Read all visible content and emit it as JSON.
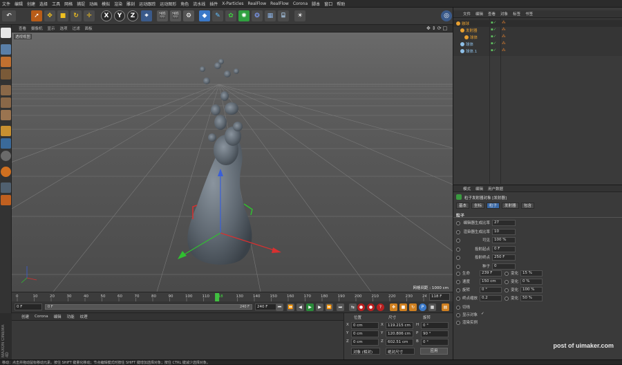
{
  "menu": [
    "文件",
    "编辑",
    "创建",
    "选择",
    "工具",
    "网格",
    "捕捉",
    "动画",
    "模拟",
    "渲染",
    "雕刻",
    "运动跟踪",
    "运动图形",
    "角色",
    "流水线",
    "插件",
    "X-Particles",
    "RealFlow",
    "RealFlow",
    "Corona",
    "脚本",
    "窗口",
    "帮助"
  ],
  "viewport": {
    "menu": [
      "查看",
      "摄像机",
      "显示",
      "选项",
      "过滤",
      "面板"
    ],
    "label": "透视视图",
    "grid_distance": "网格间距 : 1000 cm"
  },
  "timeline": {
    "ticks": [
      "0",
      "10",
      "20",
      "30",
      "40",
      "50",
      "60",
      "70",
      "80",
      "90",
      "100",
      "110",
      "118",
      "130",
      "140",
      "150",
      "160",
      "170",
      "180",
      "190",
      "200",
      "210",
      "220",
      "230",
      "240"
    ],
    "current_frame": "118 F",
    "current_value": 118,
    "end_value": 240
  },
  "playback": {
    "start": "0 F",
    "min": "0 F",
    "max": "240 F",
    "end": "240 F"
  },
  "material": {
    "menu": [
      "创建",
      "Corona",
      "编辑",
      "功能",
      "纹理"
    ]
  },
  "maxon": "MAXON CINEMA 4D",
  "coords": {
    "headers": [
      "位置",
      "尺寸",
      "旋转"
    ],
    "rows": [
      {
        "axis": "X",
        "pos": "0 cm",
        "size_axis": "X",
        "size": "119.215 cm",
        "rot_axis": "H",
        "rot": "0 °"
      },
      {
        "axis": "Y",
        "pos": "0 cm",
        "size_axis": "Y",
        "size": "120.806 cm",
        "rot_axis": "P",
        "rot": "90 °"
      },
      {
        "axis": "Z",
        "pos": "0 cm",
        "size_axis": "Z",
        "size": "602.51 cm",
        "rot_axis": "B",
        "rot": "0 °"
      }
    ],
    "mode1": "对象 (相对)",
    "mode2": "绝对尺寸",
    "apply": "应用"
  },
  "status": "移动：点击并拖动鼠标移动元素。按住 SHIFT 键量化移动；节点编辑模式时按住 SHIFT 键增加选择对象；按住 CTRL 键减少选择对象。",
  "objects": {
    "tabs": [
      "文件",
      "编辑",
      "查看",
      "对象",
      "标签",
      "书签"
    ],
    "items": [
      {
        "name": "融球",
        "indent": 0,
        "color": "#e8a030"
      },
      {
        "name": "发射器",
        "indent": 1,
        "color": "#e8a030"
      },
      {
        "name": "球体",
        "indent": 2,
        "color": "#e8a030"
      },
      {
        "name": "球体",
        "indent": 1,
        "color": "#8fc0e8"
      },
      {
        "name": "球体.1",
        "indent": 1,
        "color": "#8fc0e8"
      }
    ]
  },
  "attributes": {
    "menu": [
      "模式",
      "编辑",
      "用户数据"
    ],
    "title": "粒子发射器对象 [发射器]",
    "tabs": [
      "基本",
      "坐标",
      "粒子",
      "发射器",
      "包含"
    ],
    "section": "粒子",
    "rows": [
      {
        "label": "编辑器生成比率",
        "value": "27"
      },
      {
        "label": "渲染器生成比率",
        "value": "10"
      },
      {
        "label": "可见",
        "value": "100 %"
      },
      {
        "label": "投射起点",
        "value": "0 F"
      },
      {
        "label": "投射终点",
        "value": "250 F"
      },
      {
        "label": "种子",
        "value": "0"
      }
    ],
    "pairs": [
      {
        "label": "生命",
        "value": "239 F",
        "label2": "变化",
        "value2": "15 %"
      },
      {
        "label": "速度",
        "value": "150 cm",
        "label2": "变化",
        "value2": "0 %"
      },
      {
        "label": "旋转",
        "value": "0 °",
        "label2": "变化",
        "value2": "100 %"
      },
      {
        "label": "终点缩放",
        "value": "0.2",
        "label2": "变化",
        "value2": "50 %"
      }
    ],
    "checks": [
      {
        "label": "切线",
        "checked": ""
      },
      {
        "label": "显示对象",
        "checked": "✓"
      },
      {
        "label": "渲染实例",
        "checked": ""
      }
    ]
  },
  "watermark": "post of uimaker.com"
}
